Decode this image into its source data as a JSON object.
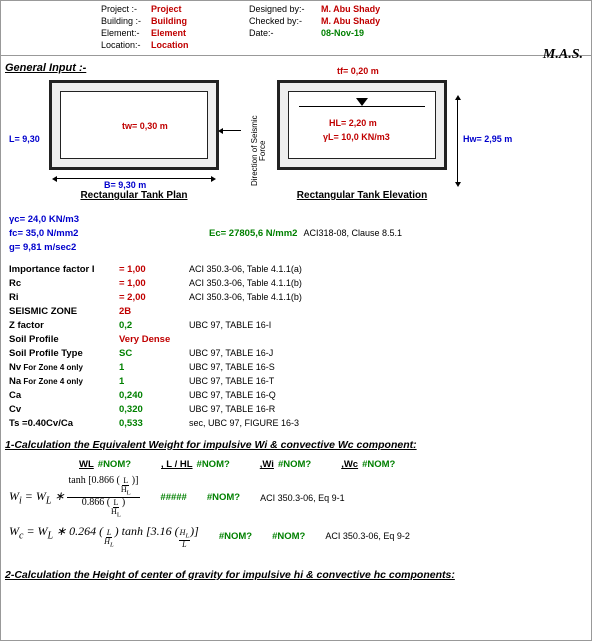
{
  "header": {
    "project_label": "Project :-",
    "project_val": "Project",
    "building_label": "Building :-",
    "building_val": "Building",
    "element_label": "Element:-",
    "element_val": "Element",
    "location_label": "Location:-",
    "location_val": "Location",
    "designed_label": "Designed by:-",
    "designed_val": "M. Abu Shady",
    "checked_label": "Checked by:-",
    "checked_val": "M. Abu Shady",
    "date_label": "Date:-",
    "date_val": "08-Nov-19",
    "mas": "M.A.S."
  },
  "general_input_title": "General Input :-",
  "plan": {
    "L": "L= 9,30",
    "tw": "tw= 0,30 m",
    "B": "B= 9,30 m",
    "caption": "Rectangular Tank Plan"
  },
  "direction": "Direction of\nSeismic Force",
  "elev": {
    "tf": "tf= 0,20 m",
    "HL": "HL= 2,20 m",
    "yL": "γL= 10,0 KN/m3",
    "Hw": "Hw= 2,95 m",
    "caption": "Rectangular Tank Elevation"
  },
  "props": {
    "yc": "γc= 24,0 KN/m3",
    "fc": "fc= 35,0 N/mm2",
    "g": "g= 9,81 m/sec2",
    "Ec_label": "Ec= 27805,6 N/mm2",
    "Ec_ref": "ACI318-08, Clause 8.5.1"
  },
  "params": [
    {
      "label": "Importance factor I",
      "val": "= 1,00",
      "ref": "ACI 350.3-06, Table 4.1.1(a)"
    },
    {
      "label": "Rc",
      "val": "= 1,00",
      "ref": "ACI 350.3-06, Table 4.1.1(b)"
    },
    {
      "label": "Ri",
      "val": "= 2,00",
      "ref": "ACI 350.3-06, Table 4.1.1(b)"
    },
    {
      "label": "SEISMIC ZONE",
      "val": "2B",
      "ref": ""
    },
    {
      "label": "Z factor",
      "val": "0,2",
      "ref": "UBC 97, TABLE 16-I"
    },
    {
      "label": "Soil Profile",
      "val": "Very Dense",
      "ref": ""
    },
    {
      "label": "Soil Profile Type",
      "val": "SC",
      "ref": "UBC 97, TABLE 16-J"
    },
    {
      "label": "Nv For Zone 4 only",
      "val": "1",
      "ref": "UBC 97, TABLE 16-S"
    },
    {
      "label": "Na For Zone 4 only",
      "val": "1",
      "ref": "UBC 97, TABLE 16-T"
    },
    {
      "label": "Ca",
      "val": "0,240",
      "ref": "UBC 97, TABLE 16-Q"
    },
    {
      "label": "Cv",
      "val": "0,320",
      "ref": "UBC 97, TABLE 16-R"
    },
    {
      "label": "Ts =0.40Cv/Ca",
      "val": "0,533",
      "ref": "sec, UBC 97, FIGURE 16-3"
    }
  ],
  "calc1": {
    "title": "1-Calculation the Equivalent Weight for impulsive Wi & convective Wc component:",
    "heads": [
      {
        "l": "WL",
        "v": "#NOM?"
      },
      {
        "l": ", L / HL",
        "v": "#NOM?"
      },
      {
        "l": ",Wi",
        "v": "#NOM?"
      },
      {
        "l": ",Wc",
        "v": "#NOM?"
      }
    ],
    "eq1": {
      "hash": "#####",
      "nom": "#NOM?",
      "ref": "ACI 350.3-06, Eq 9-1"
    },
    "eq2": {
      "nom1": "#NOM?",
      "nom2": "#NOM?",
      "ref": "ACI 350.3-06, Eq 9-2"
    }
  },
  "calc2": {
    "title": "2-Calculation the Height of center of gravity for impulsive hi & convective hc components:"
  }
}
